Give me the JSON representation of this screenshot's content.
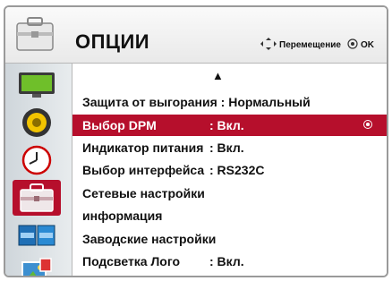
{
  "header": {
    "title": "ОПЦИИ",
    "nav_hint": "Перемещение",
    "ok_hint": "OK",
    "icon": "toolbox-icon"
  },
  "sidebar": {
    "items": [
      {
        "name": "picture",
        "icon": "monitor-icon",
        "active": false
      },
      {
        "name": "audio",
        "icon": "speaker-icon",
        "active": false
      },
      {
        "name": "time",
        "icon": "clock-icon",
        "active": false
      },
      {
        "name": "options",
        "icon": "toolbox-icon",
        "active": true
      },
      {
        "name": "input",
        "icon": "input-panels-icon",
        "active": false
      },
      {
        "name": "media",
        "icon": "photo-icon",
        "active": false
      }
    ]
  },
  "menu": {
    "scroll_up": "▲",
    "items": [
      {
        "label": "Защита от выгорания : Нормальный",
        "value": ""
      },
      {
        "label": "Выбор DPM",
        "value": ": Вкл."
      },
      {
        "label": "Индикатор питания",
        "value": ": Вкл."
      },
      {
        "label": "Выбор интерфейса",
        "value": ": RS232C"
      },
      {
        "label": "Сетевые настройки",
        "value": ""
      },
      {
        "label": "информация",
        "value": ""
      },
      {
        "label": "Заводские настройки",
        "value": ""
      },
      {
        "label": "Подсветка Лого",
        "value": ": Вкл."
      }
    ],
    "selected_index": 1
  },
  "colors": {
    "accent": "#b60f2c",
    "header_bg": "#efefef",
    "sidebar_bg": "#dde2e5"
  }
}
